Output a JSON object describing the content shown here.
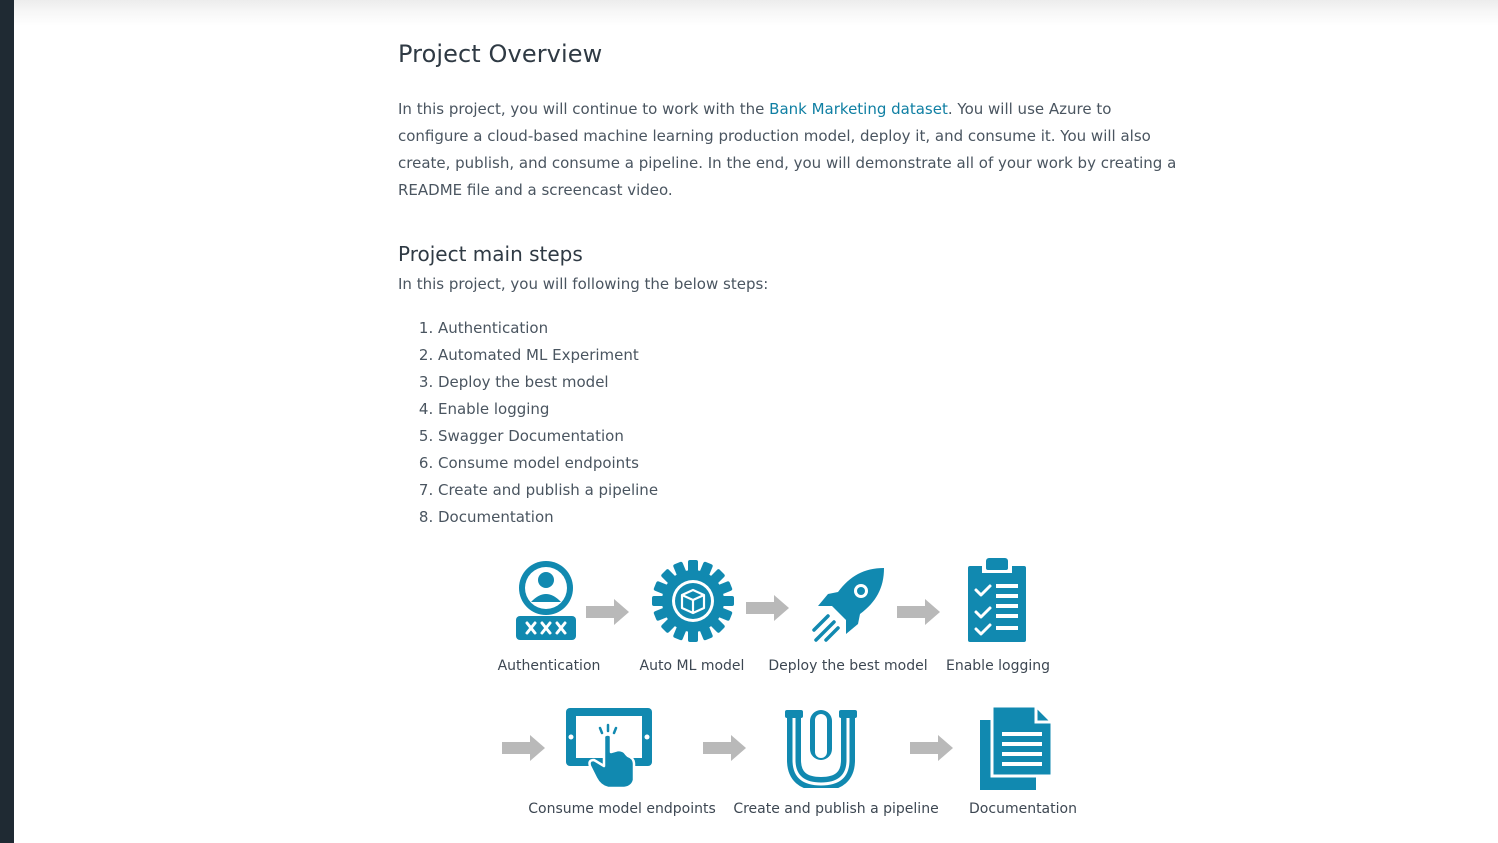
{
  "overview": {
    "title": "Project Overview",
    "intro_before_link": "In this project, you will continue to work with the ",
    "link_text": "Bank Marketing dataset",
    "intro_after_link": ". You will use Azure to configure a cloud-based machine learning production model, deploy it, and consume it. You will also create, publish, and consume a pipeline. In the end, you will demonstrate all of your work by creating a README file and a screencast video."
  },
  "steps_section": {
    "heading": "Project main steps",
    "intro": "In this project, you will following the below steps:",
    "items": [
      "Authentication",
      "Automated ML Experiment",
      "Deploy the best model",
      "Enable logging",
      "Swagger Documentation",
      "Consume model endpoints",
      "Create and publish a pipeline",
      "Documentation"
    ]
  },
  "diagram": {
    "labels": [
      "Authentication",
      "Auto ML model",
      "Deploy the best model",
      "Enable logging",
      "Consume model endpoints",
      "Create and publish a pipeline",
      "Documentation"
    ],
    "icons": [
      "user-lock-icon",
      "gear-cube-icon",
      "rocket-icon",
      "checklist-icon",
      "tablet-touch-icon",
      "pipe-icon",
      "documents-icon"
    ],
    "icon_color": "#1189b0",
    "arrow_color": "#b9b9b9"
  }
}
